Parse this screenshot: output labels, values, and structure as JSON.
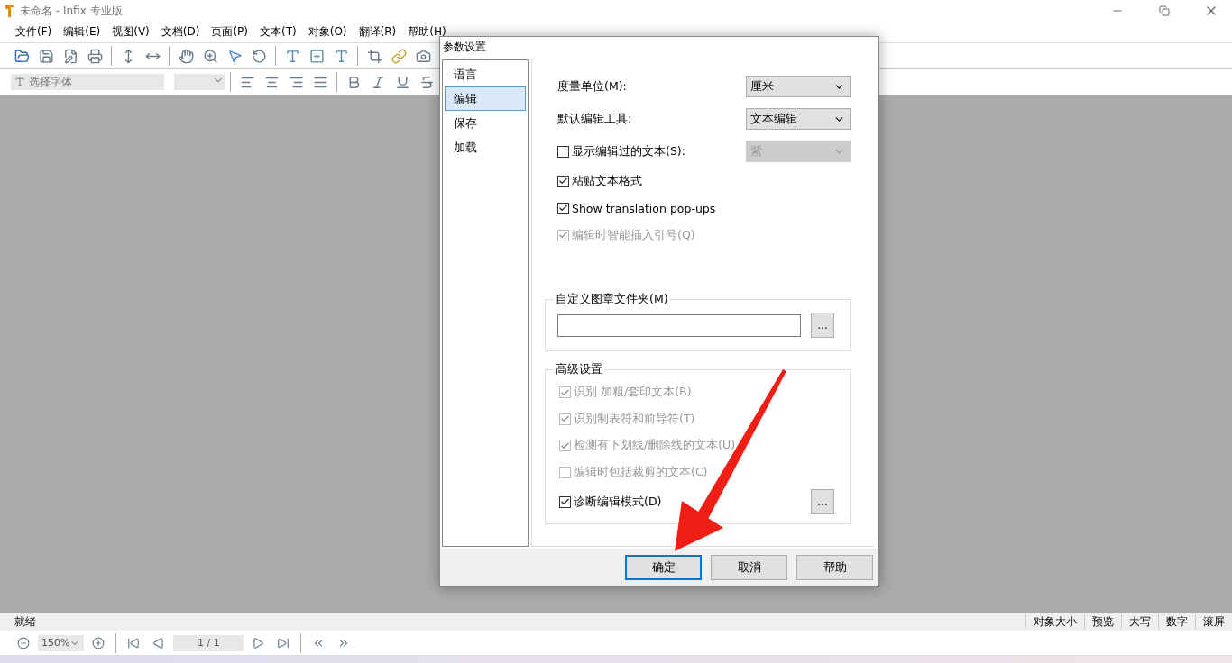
{
  "window": {
    "title": "未命名 - Infix 专业版"
  },
  "menu": [
    "文件(F)",
    "编辑(E)",
    "视图(V)",
    "文档(D)",
    "页面(P)",
    "文本(T)",
    "对象(O)",
    "翻译(R)",
    "帮助(H)"
  ],
  "format_bar": {
    "font_placeholder": "选择字体"
  },
  "dialog": {
    "title": "参数设置",
    "categories": [
      {
        "label": "语言",
        "selected": false
      },
      {
        "label": "编辑",
        "selected": true
      },
      {
        "label": "保存",
        "selected": false
      },
      {
        "label": "加载",
        "selected": false
      }
    ],
    "selects": [
      {
        "label": "度量单位(M):",
        "value": "厘米"
      },
      {
        "label": "默认编辑工具:",
        "value": "文本编辑"
      }
    ],
    "options": [
      {
        "label": "显示编辑过的文本(S):",
        "checked": false,
        "disabled": false,
        "select_value": "紫"
      },
      {
        "label": "粘贴文本格式",
        "checked": true,
        "disabled": false
      },
      {
        "label": "Show translation pop-ups",
        "checked": true,
        "disabled": false
      },
      {
        "label": "编辑时智能插入引号(Q)",
        "checked": true,
        "disabled": true
      }
    ],
    "folder_group": {
      "title": "自定义图章文件夹(M)",
      "browse": "..."
    },
    "advanced": {
      "title": "高级设置",
      "options": [
        {
          "label": "识别 加粗/套印文本(B)",
          "checked": true,
          "disabled": true
        },
        {
          "label": "识别制表符和前导符(T)",
          "checked": true,
          "disabled": true
        },
        {
          "label": "检测有下划线/删除线的文本(U)",
          "checked": true,
          "disabled": true
        },
        {
          "label": "编辑时包括裁剪的文本(C)",
          "checked": false,
          "disabled": true
        },
        {
          "label": "诊断编辑模式(D)",
          "checked": true,
          "disabled": false
        }
      ],
      "browse": "..."
    },
    "buttons": [
      {
        "label": "确定",
        "selected": true
      },
      {
        "label": "取消",
        "selected": false
      },
      {
        "label": "帮助",
        "selected": false
      }
    ]
  },
  "status_bar": {
    "message": "就绪",
    "segments": [
      "对象大小",
      "预览",
      "大写",
      "数字",
      "滚屏"
    ]
  },
  "nav_bar": {
    "zoom": "150%",
    "page": "1 / 1"
  }
}
